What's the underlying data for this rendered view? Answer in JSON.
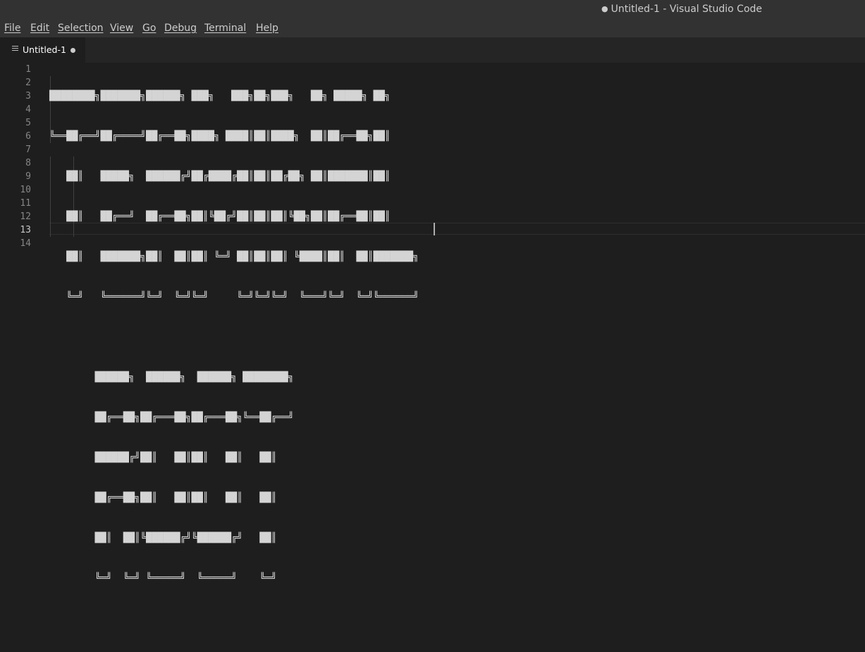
{
  "window": {
    "title": "Untitled-1 - Visual Studio Code",
    "dirty_indicator": "●"
  },
  "menubar": {
    "items": [
      "File",
      "Edit",
      "Selection",
      "View",
      "Go",
      "Debug",
      "Terminal",
      "Help"
    ]
  },
  "tabs": [
    {
      "label": "Untitled-1",
      "icon": "file-lines-icon",
      "modified": true
    }
  ],
  "editor": {
    "line_numbers": [
      "1",
      "2",
      "3",
      "4",
      "5",
      "6",
      "7",
      "8",
      "9",
      "10",
      "11",
      "12",
      "13",
      "14"
    ],
    "active_line": "13",
    "lines": [
      "████████╗███████╗██████╗ ███╗   ███╗██╗███╗   ██╗ █████╗ ██╗",
      "╚══██╔══╝██╔════╝██╔══██╗████╗ ████║██║████╗  ██║██╔══██╗██║",
      "   ██║   █████╗  ██████╔╝██╔████╔██║██║██╔██╗ ██║███████║██║",
      "   ██║   ██╔══╝  ██╔══██╗██║╚██╔╝██║██║██║╚██╗██║██╔══██║██║",
      "   ██║   ███████╗██║  ██║██║ ╚═╝ ██║██║██║ ╚████║██║  ██║███████╗",
      "   ╚═╝   ╚══════╝╚═╝  ╚═╝╚═╝     ╚═╝╚═╝╚═╝  ╚═══╝╚═╝  ╚═╝╚══════╝",
      "",
      "        ██████╗  ██████╗  ██████╗ ████████╗",
      "        ██╔══██╗██╔═══██╗██╔═══██╗╚══██╔══╝",
      "        ██████╔╝██║   ██║██║   ██║   ██║",
      "        ██╔══██╗██║   ██║██║   ██║   ██║",
      "        ██║  ██║╚██████╔╝╚██████╔╝   ██║",
      "        ╚═╝  ╚═╝ ╚═════╝  ╚═════╝    ╚═╝",
      ""
    ]
  },
  "colors": {
    "titlebar_bg": "#323233",
    "editor_bg": "#1e1e1e",
    "tabbar_bg": "#252526",
    "text": "#cccccc"
  }
}
